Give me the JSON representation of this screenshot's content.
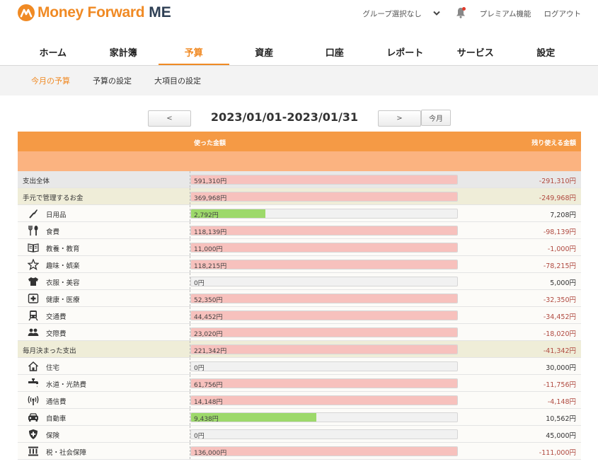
{
  "brand": {
    "name": "Money Forward",
    "suffix": "ME",
    "color": "#f08a24"
  },
  "topbar": {
    "group_select": "グループ選択なし",
    "premium": "プレミアム機能",
    "logout": "ログアウト"
  },
  "nav": {
    "tabs": [
      {
        "label": "ホーム",
        "active": false
      },
      {
        "label": "家計簿",
        "active": false
      },
      {
        "label": "予算",
        "active": true
      },
      {
        "label": "資産",
        "active": false
      },
      {
        "label": "口座",
        "active": false
      },
      {
        "label": "レポート",
        "active": false
      },
      {
        "label": "サービス",
        "active": false
      },
      {
        "label": "設定",
        "active": false
      }
    ]
  },
  "subnav": {
    "items": [
      "今月の予算",
      "予算の設定",
      "大項目の設定"
    ],
    "active_index": 0
  },
  "period": {
    "prev": "<",
    "label": "2023/01/01-2023/01/31",
    "next": ">",
    "today": "今月"
  },
  "table": {
    "col_used": "使った金額",
    "col_remaining": "残り使える金額",
    "rows": [
      {
        "type": "total",
        "name": "支出全体",
        "used": "591,310円",
        "fill": 1.0,
        "over": true,
        "remaining": "-291,310円",
        "neg": true
      },
      {
        "type": "group",
        "name": "手元で管理するお金",
        "used": "369,968円",
        "fill": 1.0,
        "over": true,
        "remaining": "-249,968円",
        "neg": true
      },
      {
        "type": "item",
        "icon": "daily-goods-icon",
        "name": "日用品",
        "used": "2,792円",
        "fill": 0.279,
        "over": false,
        "remaining": "7,208円",
        "neg": false
      },
      {
        "type": "item",
        "icon": "food-icon",
        "name": "食費",
        "used": "118,139円",
        "fill": 1.0,
        "over": true,
        "remaining": "-98,139円",
        "neg": true
      },
      {
        "type": "item",
        "icon": "book-icon",
        "name": "教養・教育",
        "used": "11,000円",
        "fill": 1.0,
        "over": true,
        "remaining": "-1,000円",
        "neg": true
      },
      {
        "type": "item",
        "icon": "star-icon",
        "name": "趣味・娯楽",
        "used": "118,215円",
        "fill": 1.0,
        "over": true,
        "remaining": "-78,215円",
        "neg": true
      },
      {
        "type": "item",
        "icon": "shirt-icon",
        "name": "衣服・美容",
        "used": "0円",
        "fill": 0,
        "over": false,
        "remaining": "5,000円",
        "neg": false
      },
      {
        "type": "item",
        "icon": "medical-icon",
        "name": "健康・医療",
        "used": "52,350円",
        "fill": 1.0,
        "over": true,
        "remaining": "-32,350円",
        "neg": true
      },
      {
        "type": "item",
        "icon": "train-icon",
        "name": "交通費",
        "used": "44,452円",
        "fill": 1.0,
        "over": true,
        "remaining": "-34,452円",
        "neg": true
      },
      {
        "type": "item",
        "icon": "people-icon",
        "name": "交際費",
        "used": "23,020円",
        "fill": 1.0,
        "over": true,
        "remaining": "-18,020円",
        "neg": true
      },
      {
        "type": "group",
        "name": "毎月決まった支出",
        "used": "221,342円",
        "fill": 1.0,
        "over": true,
        "remaining": "-41,342円",
        "neg": true
      },
      {
        "type": "item",
        "icon": "house-icon",
        "name": "住宅",
        "used": "0円",
        "fill": 0,
        "over": false,
        "remaining": "30,000円",
        "neg": false
      },
      {
        "type": "item",
        "icon": "faucet-icon",
        "name": "水道・光熱費",
        "used": "61,756円",
        "fill": 1.0,
        "over": true,
        "remaining": "-11,756円",
        "neg": true
      },
      {
        "type": "item",
        "icon": "signal-icon",
        "name": "通信費",
        "used": "14,148円",
        "fill": 1.0,
        "over": true,
        "remaining": "-4,148円",
        "neg": true
      },
      {
        "type": "item",
        "icon": "car-icon",
        "name": "自動車",
        "used": "9,438円",
        "fill": 0.472,
        "over": false,
        "remaining": "10,562円",
        "neg": false
      },
      {
        "type": "item",
        "icon": "shield-icon",
        "name": "保険",
        "used": "0円",
        "fill": 0,
        "over": false,
        "remaining": "45,000円",
        "neg": false
      },
      {
        "type": "item",
        "icon": "bank-icon",
        "name": "税・社会保障",
        "used": "136,000円",
        "fill": 1.0,
        "over": true,
        "remaining": "-111,000円",
        "neg": true
      }
    ]
  }
}
